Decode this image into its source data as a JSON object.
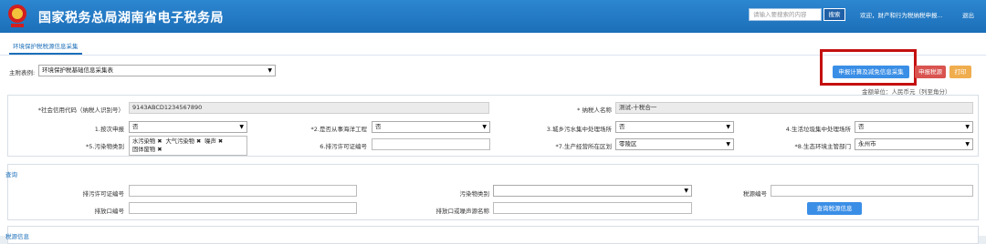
{
  "header": {
    "title": "国家税务总局湖南省电子税务局",
    "search_placeholder": "请输入要搜索的内容",
    "search_button": "搜索",
    "welcome": "欢迎，财产和行为税纳税申报...",
    "logout": "退出"
  },
  "tabs": [
    {
      "label": "环境保护税税源信息采集"
    }
  ],
  "form": {
    "main_table_label": "主附表例:",
    "main_table_value": "环境保护税基础信息采集表",
    "unit_note": "金额单位：人民币元（列至角分）",
    "buttons": {
      "calc": "申报计算及减免信息采集",
      "declare": "申报税源",
      "print": "打印"
    },
    "credit_code_label": "*社会信用代码（纳税人识别号）",
    "credit_code_value": "9143ABCD1234567890",
    "taxpayer_name_label": "* 纳税人名称",
    "taxpayer_name_value": "测试-十税合一",
    "q1_label": "1.按次申报",
    "q1_value": "否",
    "q2_label": "*2.是否从事海洋工程",
    "q2_value": "否",
    "q3_label": "3.城乡污水集中处理场所",
    "q3_value": "否",
    "q4_label": "4.生活垃圾集中处理场所",
    "q4_value": "否",
    "q5_label": "*5.污染物类别",
    "q5_tags": [
      "水污染物 ✖",
      "大气污染物 ✖",
      "噪声 ✖",
      "固体废物 ✖"
    ],
    "q6_label": "6.排污许可证编号",
    "q7_label": "*7.生产经营所在区划",
    "q7_value": "零陵区",
    "q8_label": "*8.生态环境主管部门",
    "q8_value": "永州市"
  },
  "query": {
    "title": "查询",
    "permit_label": "排污许可证编号",
    "pollutant_type_label": "污染物类别",
    "tax_source_no_label": "税源编号",
    "outlet_label": "排放口编号",
    "outlet_name_label": "排放口或噪声源名称",
    "query_button": "查询税源信息"
  },
  "bottom_section_title": "税源信息",
  "colors": {
    "header": "#1c6fb9",
    "calc_btn": "#3a8ee6",
    "declare_btn": "#d9534f",
    "print_btn": "#f0ad4e",
    "highlight": "#c41010"
  }
}
